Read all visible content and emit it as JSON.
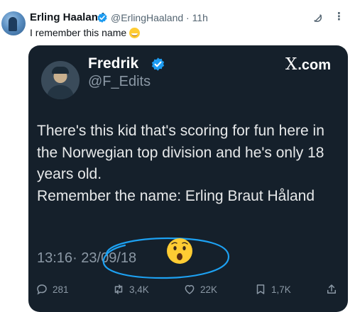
{
  "post": {
    "author_name": "Erling Haaland",
    "author_handle": "@ErlingHaaland",
    "separator": "·",
    "time_ago": "11h",
    "text": "I remember this name",
    "text_emoji": "grinning-sweat-emoji"
  },
  "quote": {
    "name": "Fredrik",
    "handle": "@F_Edits",
    "site": ".com",
    "site_logo": "X",
    "body_lines": [
      "There's this kid that's scoring for fun here in the Norwegian top division and he's only 18 years old.",
      "Remember the name: Erling Braut Håland"
    ],
    "time": "13:16",
    "date_sep": "·",
    "date": "23/09/18",
    "emoji": "astonished-face-emoji",
    "stats": {
      "replies": "281",
      "reposts": "3,4K",
      "likes": "22K",
      "bookmarks": "1,7K"
    }
  },
  "colors": {
    "verified": "#1d9bf0",
    "card_bg": "#15202b",
    "annotation": "#1da1f2"
  }
}
